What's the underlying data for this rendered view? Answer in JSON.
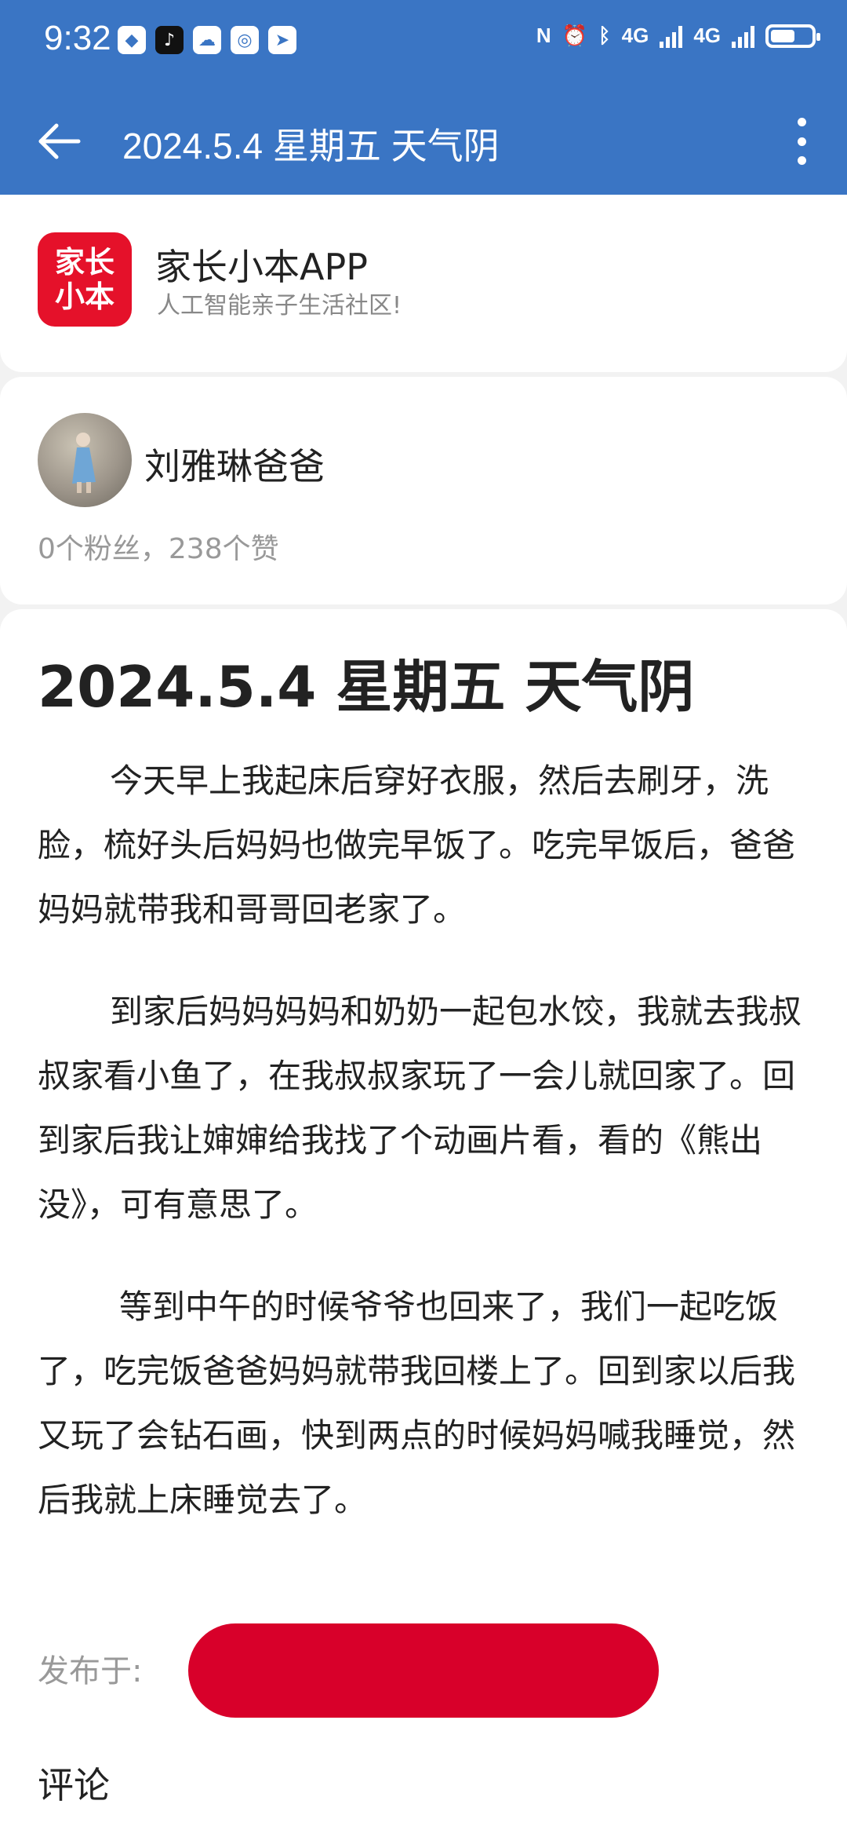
{
  "status_bar": {
    "time": "9:32",
    "network_1": "4G",
    "network_2": "4G",
    "battery_level": 0.6
  },
  "app_bar": {
    "title": "2024.5.4 星期五 天气阴"
  },
  "app_banner": {
    "logo_line1": "家长",
    "logo_line2": "小本",
    "name": "家长小本APP",
    "slogan": "人工智能亲子生活社区!"
  },
  "author": {
    "name": "刘雅琳爸爸",
    "stats": "0个粉丝，238个赞"
  },
  "article": {
    "title": "2024.5.4 星期五 天气阴",
    "paragraphs": [
      "今天早上我起床后穿好衣服，然后去刷牙，洗脸，梳好头后妈妈也做完早饭了。吃完早饭后，爸爸妈妈就带我和哥哥回老家了。",
      "到家后妈妈妈妈和奶奶一起包水饺，我就去我叔叔家看小鱼了，在我叔叔家玩了一会儿就回家了。回到家后我让婶婶给我找了个动画片看，看的《熊出没》，可有意思了。",
      "等到中午的时候爷爷也回来了，我们一起吃饭了，吃完饭爸爸妈妈就带我回楼上了。回到家以后我又玩了会钻石画，快到两点的时候妈妈喊我睡觉，然后我就上床睡觉去了。"
    ],
    "published_label": "发布于:"
  },
  "comments_label": "评论",
  "colors": {
    "header": "#3a75c4",
    "brand_red": "#e5112a",
    "redaction": "#d8002a"
  }
}
